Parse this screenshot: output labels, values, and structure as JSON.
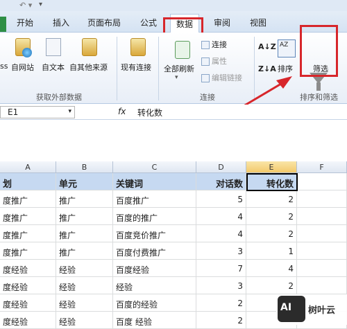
{
  "ribbon": {
    "tabs": [
      "开始",
      "插入",
      "页面布局",
      "公式",
      "数据",
      "审阅",
      "视图"
    ],
    "active_tab": "数据",
    "external_data": {
      "buttons": [
        "ss",
        "自网站",
        "自文本",
        "自其他来源",
        "现有连接"
      ],
      "group_label": "获取外部数据"
    },
    "connections": {
      "refresh_all": "全部刷新",
      "items": [
        "连接",
        "属性",
        "编辑链接"
      ],
      "group_label": "连接"
    },
    "sort_filter": {
      "sort_label": "排序",
      "filter_label": "筛选",
      "group_label": "排序和筛选"
    }
  },
  "formula_bar": {
    "name_box": "E1",
    "fx": "fx",
    "value": "转化数"
  },
  "columns": [
    "A",
    "B",
    "C",
    "D",
    "E",
    "F"
  ],
  "table": {
    "headers": [
      "划",
      "单元",
      "关键词",
      "对话数",
      "转化数"
    ],
    "rows": [
      [
        "度推广",
        "推广",
        "百度推广",
        "5",
        "2"
      ],
      [
        "度推广",
        "推广",
        "百度的推广",
        "4",
        "2"
      ],
      [
        "度推广",
        "推广",
        "百度竞价推广",
        "4",
        "2"
      ],
      [
        "度推广",
        "推广",
        "百度付费推广",
        "3",
        "1"
      ],
      [
        "度经验",
        "经验",
        "百度经验",
        "7",
        "4"
      ],
      [
        "度经验",
        "经验",
        "经验",
        "3",
        "2"
      ],
      [
        "度经验",
        "经验",
        "百度的经验",
        "2",
        "2"
      ],
      [
        "度经验",
        "经验",
        "百度 经验",
        "2",
        ""
      ]
    ]
  },
  "watermark": {
    "badge": "AI",
    "text": "树叶云"
  },
  "colors": {
    "highlight": "#d7262b",
    "header_fill": "#c6d9f1"
  }
}
